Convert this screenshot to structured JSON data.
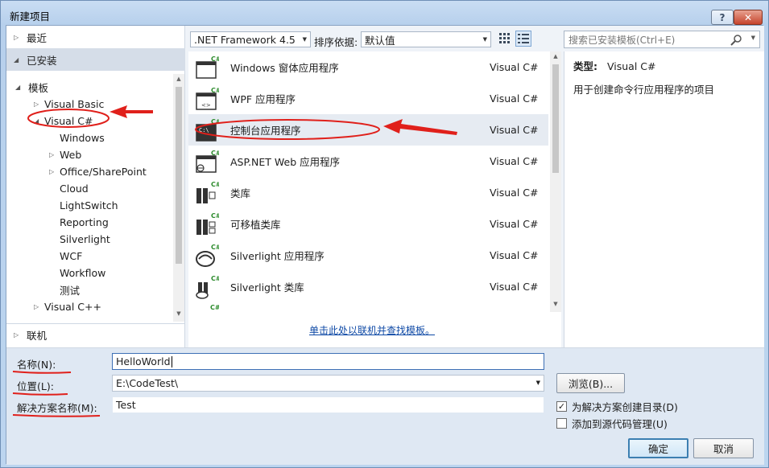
{
  "window": {
    "title": "新建项目"
  },
  "left_panel": {
    "recent": "最近",
    "installed": "已安装",
    "online": "联机",
    "tree": [
      {
        "label": "模板",
        "expanded": true
      },
      {
        "label": "Visual Basic",
        "expanded": false
      },
      {
        "label": "Visual C#",
        "expanded": true
      },
      {
        "label": "Windows"
      },
      {
        "label": "Web",
        "expanded": false
      },
      {
        "label": "Office/SharePoint",
        "expanded": false
      },
      {
        "label": "Cloud"
      },
      {
        "label": "LightSwitch"
      },
      {
        "label": "Reporting"
      },
      {
        "label": "Silverlight"
      },
      {
        "label": "WCF"
      },
      {
        "label": "Workflow"
      },
      {
        "label": "测试"
      },
      {
        "label": "Visual C++",
        "expanded": false
      }
    ]
  },
  "toolbar": {
    "framework": ".NET Framework 4.5",
    "sort_label": "排序依据:",
    "sort_value": "默认值",
    "search_placeholder": "搜索已安装模板(Ctrl+E)"
  },
  "templates": [
    {
      "name": "Windows 窗体应用程序",
      "lang": "Visual C#",
      "icon": "winforms-icon"
    },
    {
      "name": "WPF 应用程序",
      "lang": "Visual C#",
      "icon": "wpf-icon"
    },
    {
      "name": "控制台应用程序",
      "lang": "Visual C#",
      "icon": "console-icon",
      "selected": true
    },
    {
      "name": "ASP.NET Web 应用程序",
      "lang": "Visual C#",
      "icon": "web-app-icon"
    },
    {
      "name": "类库",
      "lang": "Visual C#",
      "icon": "class-library-icon"
    },
    {
      "name": "可移植类库",
      "lang": "Visual C#",
      "icon": "portable-library-icon"
    },
    {
      "name": "Silverlight 应用程序",
      "lang": "Visual C#",
      "icon": "silverlight-app-icon"
    },
    {
      "name": "Silverlight 类库",
      "lang": "Visual C#",
      "icon": "silverlight-library-icon"
    }
  ],
  "online_link": "单击此处以联机并查找模板。",
  "description": {
    "type_label": "类型:",
    "type_value": "Visual C#",
    "text": "用于创建命令行应用程序的项目"
  },
  "form": {
    "name_label": "名称(N):",
    "name_value": "HelloWorld",
    "location_label": "位置(L):",
    "location_value": "E:\\CodeTest\\",
    "solution_label": "解决方案名称(M):",
    "solution_value": "Test",
    "browse_label": "浏览(B)...",
    "create_dir_label": "为解决方案创建目录(D)",
    "create_dir_checked": true,
    "source_control_label": "添加到源代码管理(U)",
    "source_control_checked": false,
    "ok_label": "确定",
    "cancel_label": "取消"
  },
  "colors": {
    "annotation": "#e0201b",
    "link": "#0f4aa6",
    "selected_row": "#e6ebf2"
  }
}
